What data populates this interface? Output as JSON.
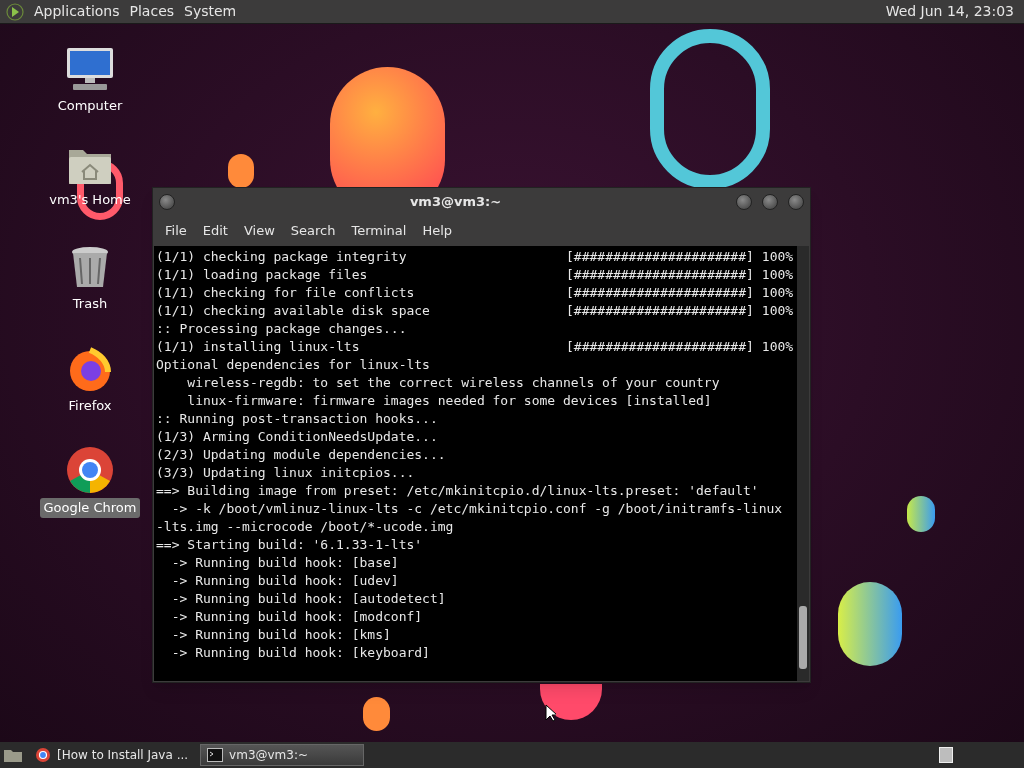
{
  "top_panel": {
    "menus": [
      "Applications",
      "Places",
      "System"
    ],
    "clock": "Wed Jun 14, 23:03"
  },
  "desktop_icons": [
    {
      "kind": "computer",
      "label": "Computer",
      "selected": false
    },
    {
      "kind": "home",
      "label": "vm3's Home",
      "selected": false
    },
    {
      "kind": "trash",
      "label": "Trash",
      "selected": false
    },
    {
      "kind": "firefox",
      "label": "Firefox",
      "selected": false
    },
    {
      "kind": "chrome",
      "label": "Google Chrom",
      "selected": true
    }
  ],
  "terminal": {
    "title": "vm3@vm3:~",
    "menu": [
      "File",
      "Edit",
      "View",
      "Search",
      "Terminal",
      "Help"
    ],
    "lines": [
      {
        "text": "(1/1) checking package integrity",
        "bar": "[######################]",
        "percent": "100%"
      },
      {
        "text": "(1/1) loading package files",
        "bar": "[######################]",
        "percent": "100%"
      },
      {
        "text": "(1/1) checking for file conflicts",
        "bar": "[######################]",
        "percent": "100%"
      },
      {
        "text": "(1/1) checking available disk space",
        "bar": "[######################]",
        "percent": "100%"
      },
      {
        "text": ":: Processing package changes..."
      },
      {
        "text": "(1/1) installing linux-lts",
        "bar": "[######################]",
        "percent": "100%"
      },
      {
        "text": "Optional dependencies for linux-lts"
      },
      {
        "text": "    wireless-regdb: to set the correct wireless channels of your country"
      },
      {
        "text": "    linux-firmware: firmware images needed for some devices [installed]"
      },
      {
        "text": ":: Running post-transaction hooks..."
      },
      {
        "text": "(1/3) Arming ConditionNeedsUpdate..."
      },
      {
        "text": "(2/3) Updating module dependencies..."
      },
      {
        "text": "(3/3) Updating linux initcpios..."
      },
      {
        "text": "==> Building image from preset: /etc/mkinitcpio.d/linux-lts.preset: 'default'"
      },
      {
        "text": "  -> -k /boot/vmlinuz-linux-lts -c /etc/mkinitcpio.conf -g /boot/initramfs-linux"
      },
      {
        "text": "-lts.img --microcode /boot/*-ucode.img"
      },
      {
        "text": "==> Starting build: '6.1.33-1-lts'"
      },
      {
        "text": "  -> Running build hook: [base]"
      },
      {
        "text": "  -> Running build hook: [udev]"
      },
      {
        "text": "  -> Running build hook: [autodetect]"
      },
      {
        "text": "  -> Running build hook: [modconf]"
      },
      {
        "text": "  -> Running build hook: [kms]"
      },
      {
        "text": "  -> Running build hook: [keyboard]"
      }
    ]
  },
  "taskbar": {
    "items": [
      {
        "kind": "browser",
        "label": "[How to Install Java ...",
        "selected": false
      },
      {
        "kind": "terminal",
        "label": "vm3@vm3:~",
        "selected": true
      }
    ]
  }
}
